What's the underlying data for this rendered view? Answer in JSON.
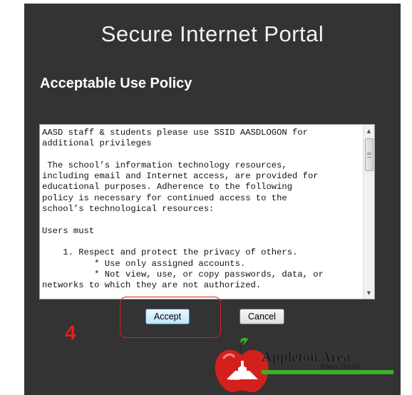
{
  "portal": {
    "title": "Secure Internet Portal",
    "heading": "Acceptable Use Policy",
    "policy_text": "AASD staff & students please use SSID AASDLOGON for\nadditional privileges\n\n The school’s information technology resources,\nincluding email and Internet access, are provided for\neducational purposes. Adherence to the following\npolicy is necessary for continued access to the\nschool’s technological resources:\n\nUsers must\n\n    1. Respect and protect the privacy of others.\n          * Use only assigned accounts.\n          * Not view, use, or copy passwords, data, or\nnetworks to which they are not authorized.",
    "accept_label": "Accept",
    "cancel_label": "Cancel"
  },
  "annotation": {
    "step_number": "4",
    "color": "#e02020"
  },
  "logo": {
    "name": "Appleton Area",
    "subtitle": "School District",
    "apple_label": "AASD",
    "apple_color": "#d4201c",
    "leaf_color": "#3dae2b"
  },
  "colors": {
    "background": "#333333",
    "accent": "#3c7fb1"
  }
}
